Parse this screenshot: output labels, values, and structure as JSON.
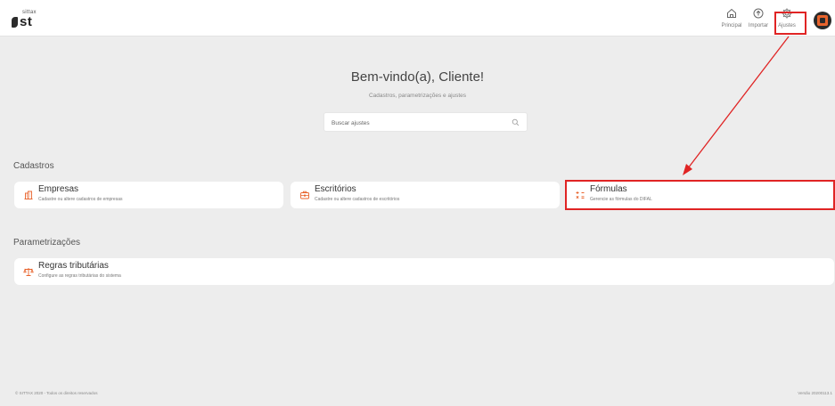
{
  "header": {
    "logo_small": "sittax",
    "logo_big": "st",
    "nav": {
      "principal_label": "Principal",
      "importar_label": "Importar",
      "ajustes_label": "Ajustes"
    }
  },
  "welcome": {
    "title": "Bem-vindo(a), Cliente!",
    "subtitle": "Cadastros, parametrizações e ajustes"
  },
  "search": {
    "placeholder": "Buscar ajustes",
    "value": ""
  },
  "sections": {
    "cadastros": {
      "title": "Cadastros",
      "cards": [
        {
          "title": "Empresas",
          "subtitle": "Cadastre ou altere cadastros de empresas",
          "icon": "building-icon"
        },
        {
          "title": "Escritórios",
          "subtitle": "Cadastre ou altere cadastros de escritórios",
          "icon": "briefcase-icon"
        },
        {
          "title": "Fórmulas",
          "subtitle": "Gerencie as fórmulas do DIFAL",
          "icon": "calculator-icon"
        }
      ]
    },
    "parametrizacoes": {
      "title": "Parametrizações",
      "cards": [
        {
          "title": "Regras tributárias",
          "subtitle": "Configure as regras tributárias do sistema",
          "icon": "scale-icon"
        }
      ]
    }
  },
  "footer": {
    "copyright": "© SITTAX 2020 - Todos os direitos reservados",
    "version": "Versão 20200113.1"
  },
  "colors": {
    "background": "#ededed",
    "highlight": "#e02424",
    "accent_icon": "#e8632c"
  }
}
